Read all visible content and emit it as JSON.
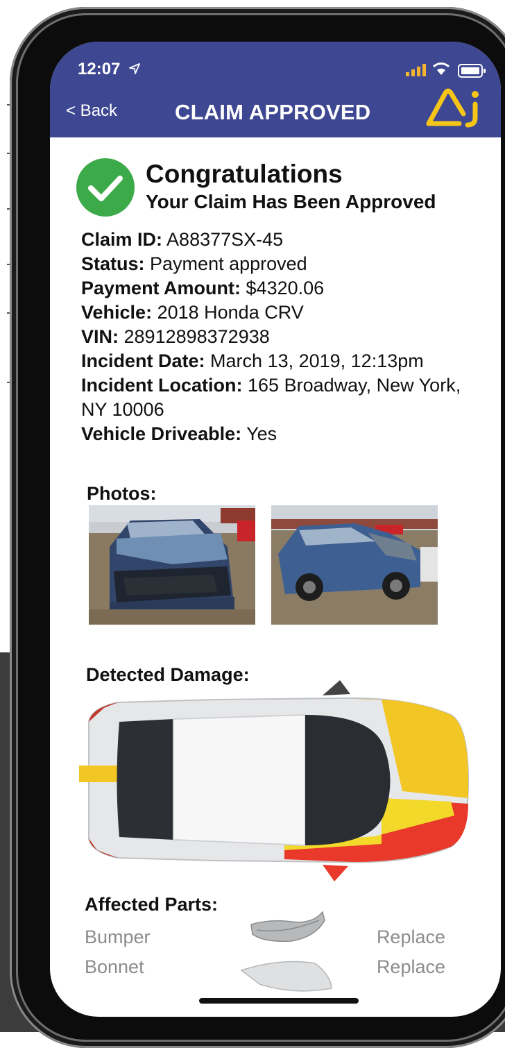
{
  "status_bar": {
    "time": "12:07"
  },
  "nav": {
    "back_label": "< Back",
    "title": "CLAIM APPROVED"
  },
  "banner": {
    "heading": "Congratulations",
    "subheading": "Your Claim Has Been Approved"
  },
  "details": [
    {
      "label": "Claim ID:",
      "value": "A88377SX-45"
    },
    {
      "label": "Status:",
      "value": "Payment approved"
    },
    {
      "label": "Payment Amount:",
      "value": "$4320.06"
    },
    {
      "label": "Vehicle:",
      "value": "2018 Honda CRV"
    },
    {
      "label": "VIN:",
      "value": "28912898372938"
    },
    {
      "label": "Incident Date:",
      "value": "March 13, 2019, 12:13pm"
    },
    {
      "label": "Incident Location:",
      "value": "165 Broadway, New York, NY 10006"
    },
    {
      "label": "Vehicle Driveable:",
      "value": "Yes"
    }
  ],
  "photos": {
    "label": "Photos:"
  },
  "damage": {
    "label": "Detected Damage:"
  },
  "parts": {
    "label": "Affected Parts:",
    "items": [
      {
        "name": "Bumper",
        "action": "Replace"
      },
      {
        "name": "Bonnet",
        "action": "Replace"
      }
    ]
  },
  "colors": {
    "header": "#3e4792",
    "logo": "#f5c518",
    "check": "#3daa4a",
    "damage_yellow": "#f2c624",
    "damage_red": "#e8392b"
  },
  "icons": [
    "location-arrow-icon",
    "signal-icon",
    "wifi-icon",
    "battery-icon",
    "check-circle-icon",
    "app-logo-icon"
  ]
}
